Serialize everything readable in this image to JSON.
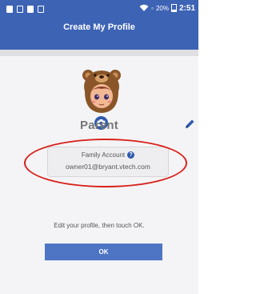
{
  "status_bar": {
    "battery": "20%",
    "time": "2:51"
  },
  "header": {
    "title": "Create My Profile"
  },
  "profile": {
    "name": "Parent",
    "avatar_icon": "bear-hood-avatar",
    "camera_icon": "camera-icon",
    "edit_icon": "pencil-icon"
  },
  "account": {
    "label": "Family Account",
    "help_glyph": "?",
    "email": "owner01@bryant.vtech.com"
  },
  "instruction": "Edit your profile, then touch OK.",
  "ok_button": {
    "label": "OK"
  },
  "colors": {
    "header": "#3d63b5",
    "button": "#4e74c4",
    "highlight_ellipse": "#d8221c"
  }
}
